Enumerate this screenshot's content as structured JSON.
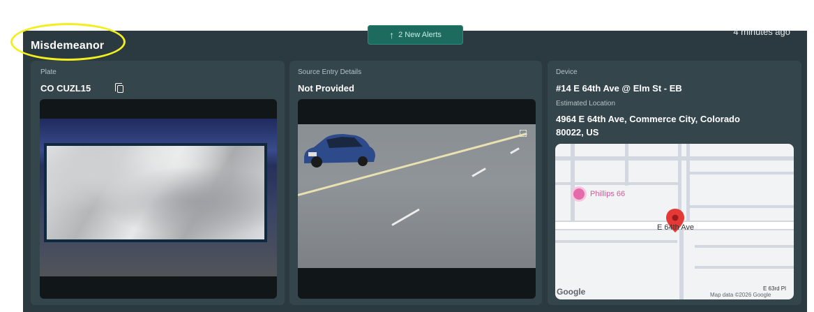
{
  "header": {
    "title": "Misdemeanor",
    "alerts_label": "2 New Alerts",
    "time_ago": "4 minutes ago"
  },
  "plate_card": {
    "label": "Plate",
    "value": "CO CUZL15"
  },
  "source_card": {
    "label": "Source Entry Details",
    "value": "Not Provided"
  },
  "device_card": {
    "label": "Device",
    "value": "#14 E 64th Ave @ Elm St - EB",
    "location_label": "Estimated Location",
    "location_line1": "4964 E 64th Ave, Commerce City, Colorado",
    "location_line2": "80022, US"
  },
  "map": {
    "poi": "Phillips 66",
    "street": "E 64th Ave",
    "street2": "E 63rd Pl",
    "logo": "Google",
    "attribution": "Map data ©2026 Google"
  },
  "colors": {
    "panel": "#2b3a40",
    "card": "#34454c",
    "alert": "#1d6b5f",
    "highlight": "#f3ee20",
    "pin": "#e53935"
  },
  "icons": [
    "copy-icon",
    "arrow-up-icon",
    "expand-icon",
    "map-pin-icon",
    "poi-pin-icon"
  ]
}
